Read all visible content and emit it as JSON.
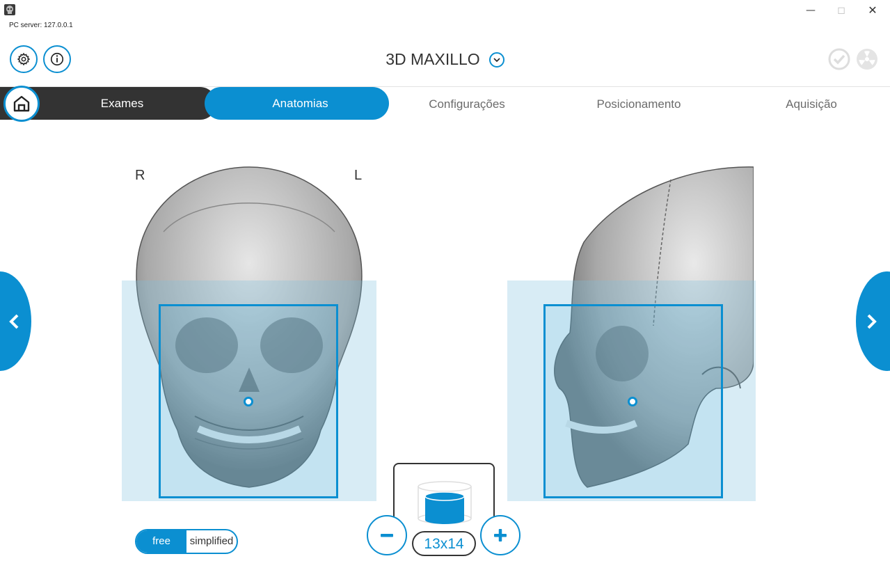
{
  "window": {
    "server_label": "PC server: 127.0.0.1",
    "app_icon": "skull-app-icon",
    "controls": [
      "minimize",
      "maximize",
      "close"
    ]
  },
  "header": {
    "title": "3D MAXILLO",
    "left_buttons": [
      {
        "icon": "gear-icon",
        "label": "settings"
      },
      {
        "icon": "info-icon",
        "label": "info"
      }
    ],
    "right_icons": [
      "check-circle-icon",
      "radiation-icon"
    ]
  },
  "tabs": {
    "home_icon": "home-icon",
    "items": [
      {
        "label": "Exames",
        "state": "done"
      },
      {
        "label": "Anatomias",
        "state": "active"
      },
      {
        "label": "Configurações",
        "state": "pending"
      },
      {
        "label": "Posicionamento",
        "state": "pending"
      },
      {
        "label": "Aquisição",
        "state": "pending"
      }
    ]
  },
  "views": {
    "frontal": {
      "left_label": "R",
      "right_label": "L"
    },
    "lateral": {}
  },
  "mode_toggle": {
    "free": "free",
    "simplified": "simplified",
    "selected": "free"
  },
  "volume": {
    "size": "13x14",
    "minus": "minus",
    "plus": "plus"
  },
  "colors": {
    "accent": "#0b8fd1",
    "dark": "#333333"
  }
}
